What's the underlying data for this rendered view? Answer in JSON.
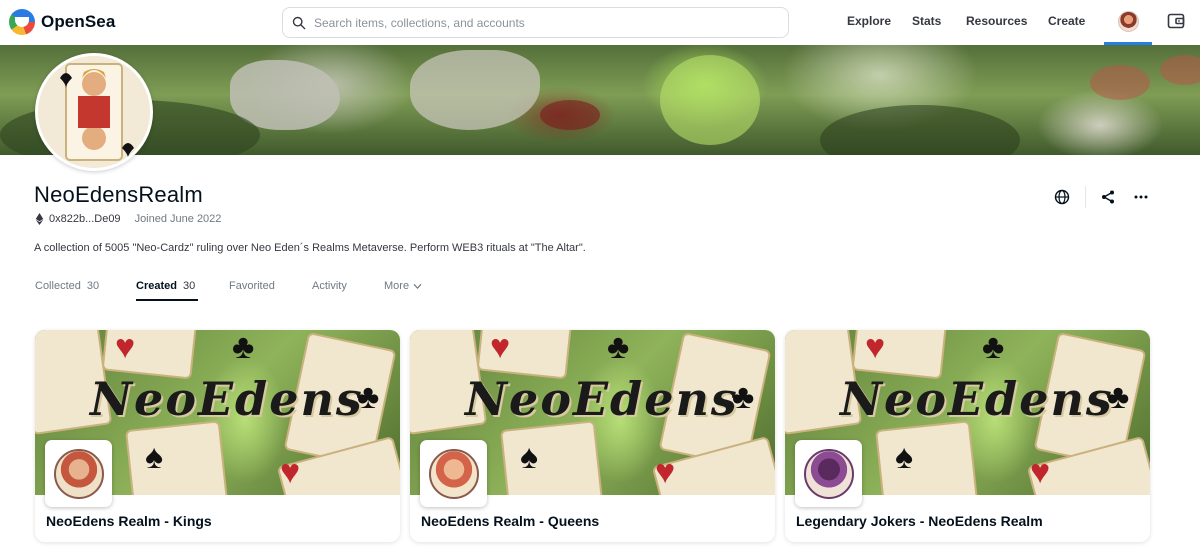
{
  "nav": {
    "brand": "OpenSea",
    "search_placeholder": "Search items, collections, and accounts",
    "links": [
      "Explore",
      "Stats",
      "Resources",
      "Create"
    ],
    "accent_color": "#2081e2"
  },
  "profile": {
    "name": "NeoEdensRealm",
    "address": "0x822b...De09",
    "joined": "Joined June 2022",
    "description": "A collection of 5005 \"Neo-Cardz\" ruling over Neo Eden´s Realms Metaverse. Perform WEB3 rituals at \"The Altar\".",
    "actions": [
      "globe-icon",
      "share-icon",
      "more-icon"
    ]
  },
  "tabs": [
    {
      "label": "Collected",
      "count": "30",
      "active": false
    },
    {
      "label": "Created",
      "count": "30",
      "active": true
    },
    {
      "label": "Favorited",
      "count": "",
      "active": false
    },
    {
      "label": "Activity",
      "count": "",
      "active": false
    },
    {
      "label": "More",
      "count": "",
      "active": false
    }
  ],
  "collections": [
    {
      "title": "NeoEdens Realm - Kings",
      "banner_word": "NeoEdens"
    },
    {
      "title": "NeoEdens Realm - Queens",
      "banner_word": "NeoEdens"
    },
    {
      "title": "Legendary Jokers - NeoEdens Realm",
      "banner_word": "NeoEdens"
    }
  ]
}
